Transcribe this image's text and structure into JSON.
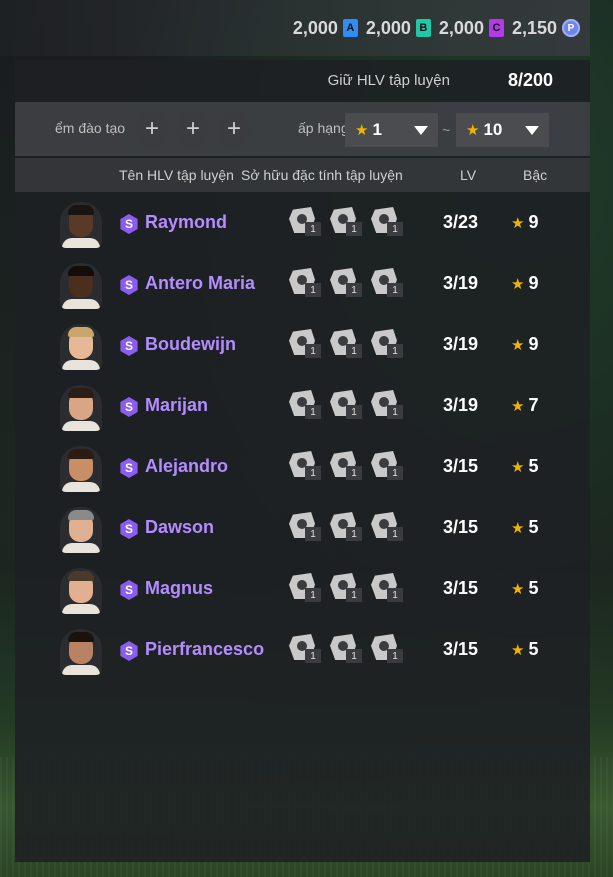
{
  "currencies": [
    {
      "amount": "2,000",
      "badge": "A",
      "color": "#2f8df5"
    },
    {
      "amount": "2,000",
      "badge": "B",
      "color": "#1fc9a8"
    },
    {
      "amount": "2,000",
      "badge": "C",
      "color": "#b23ae8"
    },
    {
      "amount": "2,150",
      "badge": "P",
      "color": "#6f86e8"
    }
  ],
  "held": {
    "label": "Giữ HLV tập luyện",
    "value": "8/200"
  },
  "filter": {
    "slot_label": "ểm đào tạo",
    "plus": "+",
    "rank_label": "ấp hạng",
    "min": "1",
    "max": "10",
    "tilde": "~"
  },
  "headers": {
    "name": "Tên HLV tập luyện",
    "traits": "Sở hữu đặc tính tập luyện",
    "lv": "LV",
    "grade": "Bậc"
  },
  "coaches": [
    {
      "name": "Raymond",
      "lv": "3/23",
      "grade": "9",
      "skin": "#5a3a26",
      "hair": "#1a1410",
      "traits": [
        "1",
        "1",
        "1"
      ]
    },
    {
      "name": "Antero Maria",
      "lv": "3/19",
      "grade": "9",
      "skin": "#4a2e1e",
      "hair": "#120d0a",
      "traits": [
        "1",
        "1",
        "1"
      ]
    },
    {
      "name": "Boudewijn",
      "lv": "3/19",
      "grade": "9",
      "skin": "#e6b898",
      "hair": "#c9a66a",
      "traits": [
        "1",
        "1",
        "1"
      ]
    },
    {
      "name": "Marijan",
      "lv": "3/19",
      "grade": "7",
      "skin": "#d9a584",
      "hair": "#2a1e16",
      "traits": [
        "1",
        "1",
        "1"
      ]
    },
    {
      "name": "Alejandro",
      "lv": "3/15",
      "grade": "5",
      "skin": "#c98e66",
      "hair": "#2a1c12",
      "traits": [
        "1",
        "1",
        "1"
      ]
    },
    {
      "name": "Dawson",
      "lv": "3/15",
      "grade": "5",
      "skin": "#e0b092",
      "hair": "#8a8a8a",
      "traits": [
        "1",
        "1",
        "1"
      ]
    },
    {
      "name": "Magnus",
      "lv": "3/15",
      "grade": "5",
      "skin": "#e2b090",
      "hair": "#4a3a2a",
      "traits": [
        "1",
        "1",
        "1"
      ]
    },
    {
      "name": "Pierfrancesco",
      "lv": "3/15",
      "grade": "5",
      "skin": "#b98262",
      "hair": "#1a120c",
      "traits": [
        "1",
        "1",
        "1"
      ]
    }
  ]
}
